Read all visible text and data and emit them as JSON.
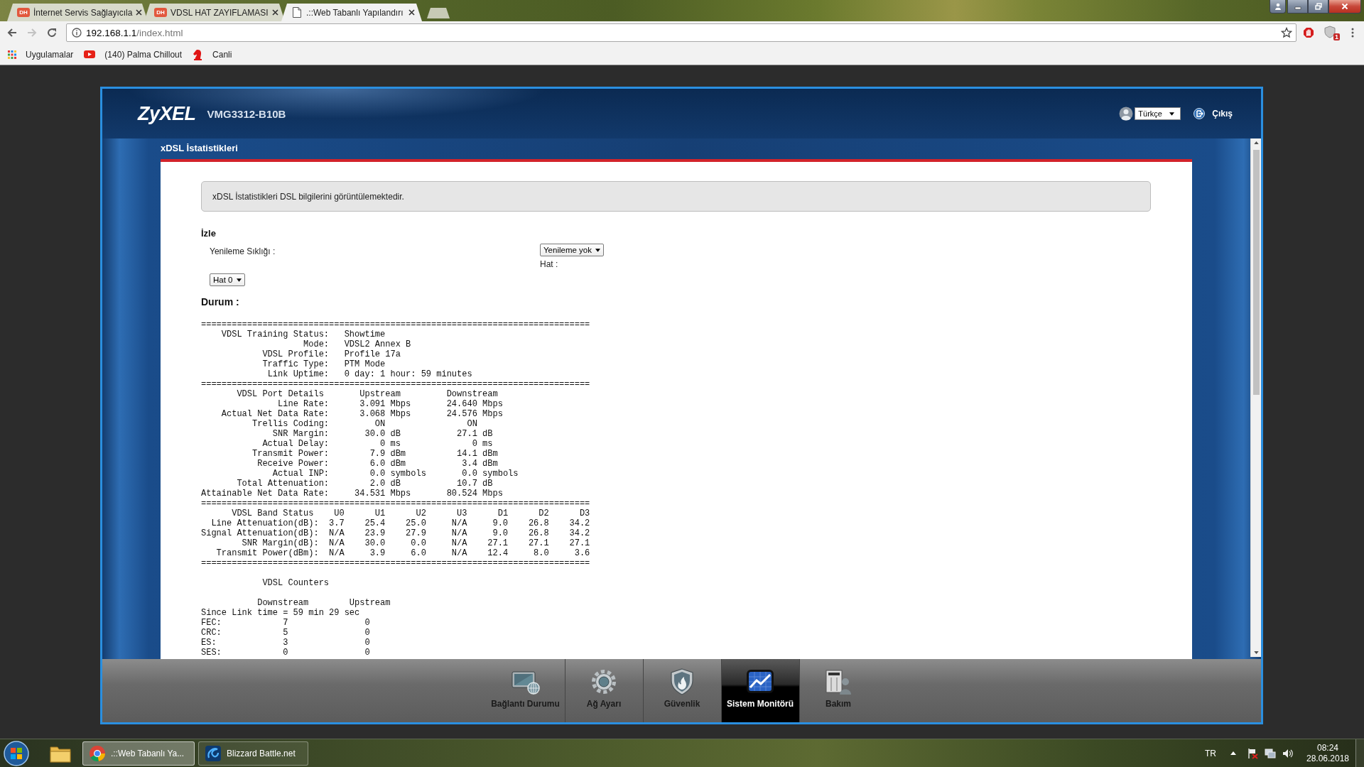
{
  "browser": {
    "tabs": [
      {
        "title": "İnternet Servis Sağlayıcıla",
        "favicon": "DH",
        "selected": false
      },
      {
        "title": "VDSL HAT ZAYIFLAMASI",
        "favicon": "DH",
        "selected": false
      },
      {
        "title": ".::Web Tabanlı Yapılandırı",
        "selected": true
      }
    ],
    "address": {
      "host": "192.168.1.1",
      "path": "/index.html"
    },
    "extension_badge": "1",
    "bookmarks": [
      "Uygulamalar",
      "(140) Palma Chillout",
      "Canli"
    ]
  },
  "router": {
    "logo": "ZyXEL",
    "model": "VMG3312-B10B",
    "language": "Türkçe",
    "logout": "Çıkış",
    "page_title": "xDSL İstatistikleri",
    "info": "xDSL İstatistikleri DSL bilgilerini görüntülemektedir.",
    "monitor": {
      "heading": "İzle",
      "refresh_label": "Yenileme Sıklığı :",
      "refresh_value": "Yenileme yok",
      "line_label": "Hat :",
      "line_value": "Hat 0"
    },
    "status": {
      "heading": "Durum :",
      "blocks": [
        {
          "lines": [
            "============================================================================",
            "    VDSL Training Status:   Showtime",
            "                    Mode:   VDSL2 Annex B",
            "            VDSL Profile:   Profile 17a",
            "            Traffic Type:   PTM Mode",
            "             Link Uptime:   0 day: 1 hour: 59 minutes",
            "============================================================================",
            "       VDSL Port Details       Upstream         Downstream",
            "               Line Rate:      3.091 Mbps       24.640 Mbps",
            "    Actual Net Data Rate:      3.068 Mbps       24.576 Mbps",
            "          Trellis Coding:         ON                ON",
            "              SNR Margin:       30.0 dB           27.1 dB",
            "            Actual Delay:          0 ms              0 ms",
            "          Transmit Power:        7.9 dBm          14.1 dBm",
            "           Receive Power:        6.0 dBm           3.4 dBm",
            "              Actual INP:        0.0 symbols       0.0 symbols",
            "       Total Attenuation:        2.0 dB           10.7 dB",
            "Attainable Net Data Rate:     34.531 Mbps       80.524 Mbps",
            "============================================================================",
            "      VDSL Band Status    U0      U1      U2      U3      D1      D2      D3",
            "  Line Attenuation(dB):  3.7    25.4    25.0     N/A     9.0    26.8    34.2",
            "Signal Attenuation(dB):  N/A    23.9    27.9     N/A     9.0    26.8    34.2",
            "        SNR Margin(dB):  N/A    30.0     0.0     N/A    27.1    27.1    27.1",
            "   Transmit Power(dBm):  N/A     3.9     6.0     N/A    12.4     8.0     3.6",
            "============================================================================"
          ]
        },
        {
          "lines": [
            "            VDSL Counters"
          ]
        },
        {
          "lines": [
            "           Downstream        Upstream",
            "Since Link time = 59 min 29 sec",
            "FEC:            7               0",
            "CRC:            5               0",
            "ES:             3               0",
            "SES:            0               0"
          ]
        }
      ]
    },
    "nav": [
      {
        "label": "Bağlantı Durumu",
        "selected": false
      },
      {
        "label": "Ağ Ayarı",
        "selected": false
      },
      {
        "label": "Güvenlik",
        "selected": false
      },
      {
        "label": "Sistem Monitörü",
        "selected": true
      },
      {
        "label": "Bakım",
        "selected": false
      }
    ]
  },
  "taskbar": {
    "windows": [
      {
        "label": ".::Web Tabanlı Ya...",
        "selected": true
      },
      {
        "label": "Blizzard Battle.net",
        "selected": false
      }
    ],
    "language": "TR",
    "time": "08:24",
    "date": "28.06.2018"
  }
}
